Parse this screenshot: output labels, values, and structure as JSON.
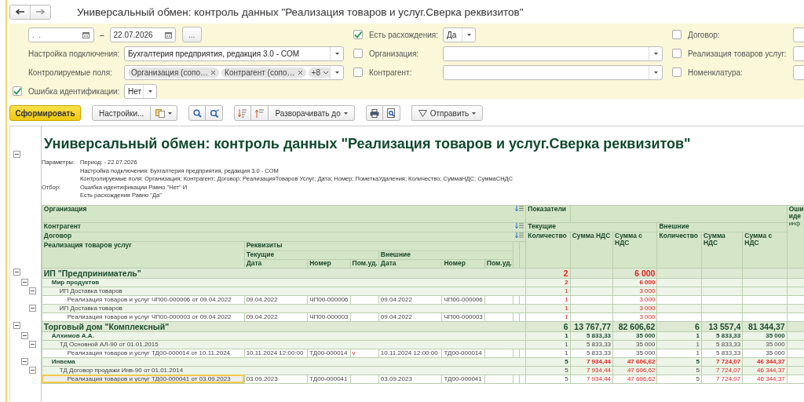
{
  "window": {
    "title": "Универсальный обмен: контроль данных \"Реализация товаров и услуг.Сверка реквизитов\""
  },
  "filters": [
    [
      {
        "kind": "period",
        "from_placeholder": ".  .",
        "separator": "–",
        "to": "22.07.2026",
        "button": "..."
      },
      {
        "kind": "combo",
        "label": "Настройка подключения:",
        "value": "Бухгалтерия предприятия, редакция 3.0 - COM"
      },
      {
        "kind": "tags",
        "label": "Контролируемые поля:",
        "tags": [
          "Организация (сопо…",
          "Контрагент (сопо…"
        ],
        "more": "+8"
      },
      {
        "kind": "select",
        "label": "Ошибка идентификации:",
        "checked": true,
        "value": "Нет"
      }
    ],
    [
      {
        "kind": "select",
        "label": "Есть расхождения:",
        "checked": true,
        "value": "Да"
      },
      {
        "kind": "combo",
        "label": "Организация:",
        "checked": false
      },
      {
        "kind": "combo",
        "label": "Контрагент:",
        "checked": false
      }
    ],
    [
      {
        "kind": "field",
        "label": "Договор:",
        "checked": false
      },
      {
        "kind": "field",
        "label": "Реализация товаров услуг:",
        "checked": false
      },
      {
        "kind": "field",
        "label": "Номенклатура:",
        "checked": false
      }
    ]
  ],
  "toolbar": {
    "generate": "Сформировать",
    "settings": "Настройки...",
    "expand": "Разворачивать до",
    "send": "Отправить"
  },
  "report": {
    "title": "Универсальный обмен: контроль данных \"Реализация товаров и услуг.Сверка реквизитов\"",
    "parameters": {
      "label": "Параметры:",
      "lines": [
        "Период:  - 22.07.2026",
        "Настройка подключения: Бухгалтерия предприятия, редакция 3.0 - COM",
        "Контролируемые поля: Организация; Контрагент; Договор; РеализацияТоваров Услуг; Дата; Номер; ПометкаУдаления; Количество; СуммаНДС; СуммаСНДС"
      ]
    },
    "filter": {
      "label": "Отбор:",
      "lines": [
        "Ошибка идентификации Равно \"Нет\" И",
        "Есть расхождения Равно \"Да\""
      ]
    }
  },
  "table": {
    "header": {
      "organization": "Организация",
      "counterparty": "Контрагент",
      "contract": "Договор",
      "document": "Реализация товаров услуг",
      "requisites": {
        "label": "Реквизиты",
        "groups": [
          {
            "label": "Текущие",
            "columns": [
              "Дата",
              "Номер",
              "Пом.уд."
            ]
          },
          {
            "label": "Внешние",
            "columns": [
              "Дата",
              "Номер",
              "Пом.уд."
            ]
          }
        ]
      },
      "indicators": {
        "label": "Показатели",
        "groups": [
          {
            "label": "Текущие",
            "columns": [
              "Количество",
              "Сумма НДС",
              "Сумма с НДС"
            ]
          },
          {
            "label": "Внешние",
            "columns": [
              "Количество",
              "Сумма НДС",
              "Сумма с НДС"
            ]
          }
        ]
      },
      "error_column": {
        "lines": [
          "Оши",
          "иде"
        ],
        "note": "инф"
      }
    },
    "organizations": [
      {
        "name": "ИП \"Предприниматель\"",
        "indicators": {
          "cur_qty": {
            "value": "2",
            "mismatch": true
          },
          "cur_total": {
            "value": "6 000",
            "mismatch": true
          }
        },
        "children": [
          {
            "name": "Мир продуктов",
            "indicators": {
              "cur_qty": {
                "value": "2",
                "mismatch": true
              },
              "cur_total": {
                "value": "6 000",
                "mismatch": true
              }
            },
            "children": [
              {
                "name": "ИП Доставка товаров",
                "indicators": {
                  "cur_qty": {
                    "value": "1",
                    "mismatch": true
                  },
                  "cur_total": {
                    "value": "3 000",
                    "mismatch": true
                  }
                },
                "children": [
                  {
                    "name": "Реализация товаров и услуг ЧП00-000006 от 09.04.2022",
                    "selected": false,
                    "current": {
                      "date": "09.04.2022",
                      "number": "ЧП00-000006"
                    },
                    "external": {
                      "date": "09.04.2022",
                      "number": "ЧП00-000006"
                    },
                    "indicators": {
                      "cur_qty": {
                        "value": "1",
                        "mismatch": true
                      },
                      "cur_total": {
                        "value": "3 000",
                        "mismatch": true
                      }
                    }
                  }
                ]
              },
              {
                "name": "ИП Доставка товаров",
                "indicators": {
                  "cur_qty": {
                    "value": "1",
                    "mismatch": true
                  },
                  "cur_total": {
                    "value": "3 000",
                    "mismatch": true
                  }
                },
                "children": [
                  {
                    "name": "Реализация товаров и услуг ЧП00-000003 от 09.04.2022",
                    "selected": false,
                    "current": {
                      "date": "09.04.2022",
                      "number": "ЧП00-000003"
                    },
                    "external": {
                      "date": "09.04.2022",
                      "number": "ЧП00-000003"
                    },
                    "indicators": {
                      "cur_qty": {
                        "value": "1",
                        "mismatch": true
                      },
                      "cur_total": {
                        "value": "3 000",
                        "mismatch": true
                      }
                    }
                  }
                ]
              }
            ]
          }
        ]
      },
      {
        "name": "Торговый дом \"Комплексный\"",
        "indicators": {
          "cur_qty": {
            "value": "6",
            "mismatch": false
          },
          "cur_vat": {
            "value": "13 767,77",
            "mismatch": false
          },
          "cur_total": {
            "value": "82 606,62",
            "mismatch": false
          },
          "ext_qty": {
            "value": "6",
            "mismatch": false
          },
          "ext_vat": {
            "value": "13 557,4",
            "mismatch": false
          },
          "ext_total": {
            "value": "81 344,37",
            "mismatch": false
          }
        },
        "children": [
          {
            "name": "Алхимов А.А.",
            "indicators": {
              "cur_qty": {
                "value": "1",
                "mismatch": false
              },
              "cur_vat": {
                "value": "5 833,33",
                "mismatch": false
              },
              "cur_total": {
                "value": "35 000",
                "mismatch": false
              },
              "ext_qty": {
                "value": "1",
                "mismatch": false
              },
              "ext_vat": {
                "value": "5 833,33",
                "mismatch": false
              },
              "ext_total": {
                "value": "35 000",
                "mismatch": false
              }
            },
            "children": [
              {
                "name": "ТД Основной АЛ-90 от 01.01.2015",
                "indicators": {
                  "cur_qty": {
                    "value": "1",
                    "mismatch": false
                  },
                  "cur_vat": {
                    "value": "5 833,33",
                    "mismatch": false
                  },
                  "cur_total": {
                    "value": "35 000",
                    "mismatch": false
                  },
                  "ext_qty": {
                    "value": "1",
                    "mismatch": false
                  },
                  "ext_vat": {
                    "value": "5 833,33",
                    "mismatch": false
                  },
                  "ext_total": {
                    "value": "35 000",
                    "mismatch": false
                  }
                },
                "children": [
                  {
                    "name": "Реализация товаров и услуг ТД00-000014 от 10.11.2024",
                    "selected": false,
                    "current": {
                      "date": "10.11.2024 12:00:00",
                      "number": "ТД00-000014",
                      "deleted": "v"
                    },
                    "external": {
                      "date": "10.11.2024 12:00:00",
                      "number": "ТД00-000014"
                    },
                    "indicators": {
                      "cur_qty": {
                        "value": "1",
                        "mismatch": false
                      },
                      "cur_vat": {
                        "value": "5 833,33",
                        "mismatch": false
                      },
                      "cur_total": {
                        "value": "35 000",
                        "mismatch": false
                      },
                      "ext_qty": {
                        "value": "1",
                        "mismatch": false
                      },
                      "ext_vat": {
                        "value": "5 833,33",
                        "mismatch": false
                      },
                      "ext_total": {
                        "value": "35 000",
                        "mismatch": false
                      }
                    }
                  }
                ]
              }
            ]
          },
          {
            "name": "Инвема",
            "indicators": {
              "cur_qty": {
                "value": "5",
                "mismatch": false
              },
              "cur_vat": {
                "value": "7 934,44",
                "mismatch": true
              },
              "cur_total": {
                "value": "47 606,62",
                "mismatch": true
              },
              "ext_qty": {
                "value": "5",
                "mismatch": false
              },
              "ext_vat": {
                "value": "7 724,07",
                "mismatch": true
              },
              "ext_total": {
                "value": "46 344,37",
                "mismatch": true
              }
            },
            "children": [
              {
                "name": "ТД Договор продажи Инв-90 от 01.01.2014",
                "indicators": {
                  "cur_qty": {
                    "value": "5",
                    "mismatch": false
                  },
                  "cur_vat": {
                    "value": "7 934,44",
                    "mismatch": true
                  },
                  "cur_total": {
                    "value": "47 606,62",
                    "mismatch": true
                  },
                  "ext_qty": {
                    "value": "5",
                    "mismatch": false
                  },
                  "ext_vat": {
                    "value": "7 724,07",
                    "mismatch": true
                  },
                  "ext_total": {
                    "value": "46 344,37",
                    "mismatch": true
                  }
                },
                "children": [
                  {
                    "name": "Реализация товаров и услуг ТД00-000041 от 03.09.2023",
                    "selected": true,
                    "current": {
                      "date": "03.09.2023",
                      "number": "ТД00-000041"
                    },
                    "external": {
                      "date": "03.09.2023",
                      "number": "ТД00-000041"
                    },
                    "indicators": {
                      "cur_qty": {
                        "value": "5",
                        "mismatch": false
                      },
                      "cur_vat": {
                        "value": "7 934,44",
                        "mismatch": true
                      },
                      "cur_total": {
                        "value": "47 606,62",
                        "mismatch": true
                      },
                      "ext_qty": {
                        "value": "5",
                        "mismatch": false
                      },
                      "ext_vat": {
                        "value": "7 724,07",
                        "mismatch": true
                      },
                      "ext_total": {
                        "value": "46 344,37",
                        "mismatch": true
                      }
                    }
                  }
                ]
              }
            ]
          }
        ]
      }
    ]
  }
}
